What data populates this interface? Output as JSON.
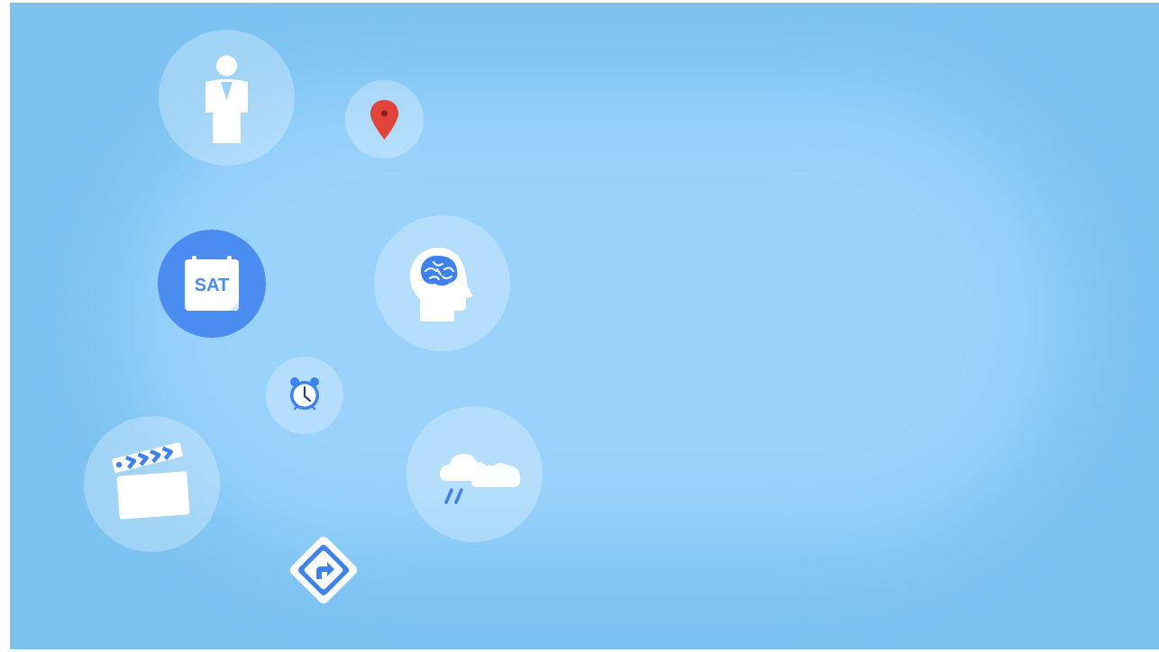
{
  "scene": {
    "background_color": "#7cc3f2",
    "glow_color": "#99d2fb",
    "accent_color": "#4a8cf0",
    "pin_color": "#e0443b"
  },
  "icons": [
    {
      "name": "person-icon"
    },
    {
      "name": "map-pin-icon"
    },
    {
      "name": "calendar-icon",
      "label": "SAT"
    },
    {
      "name": "brain-icon"
    },
    {
      "name": "alarm-clock-icon"
    },
    {
      "name": "clapperboard-icon"
    },
    {
      "name": "weather-icon"
    },
    {
      "name": "directions-icon"
    }
  ]
}
